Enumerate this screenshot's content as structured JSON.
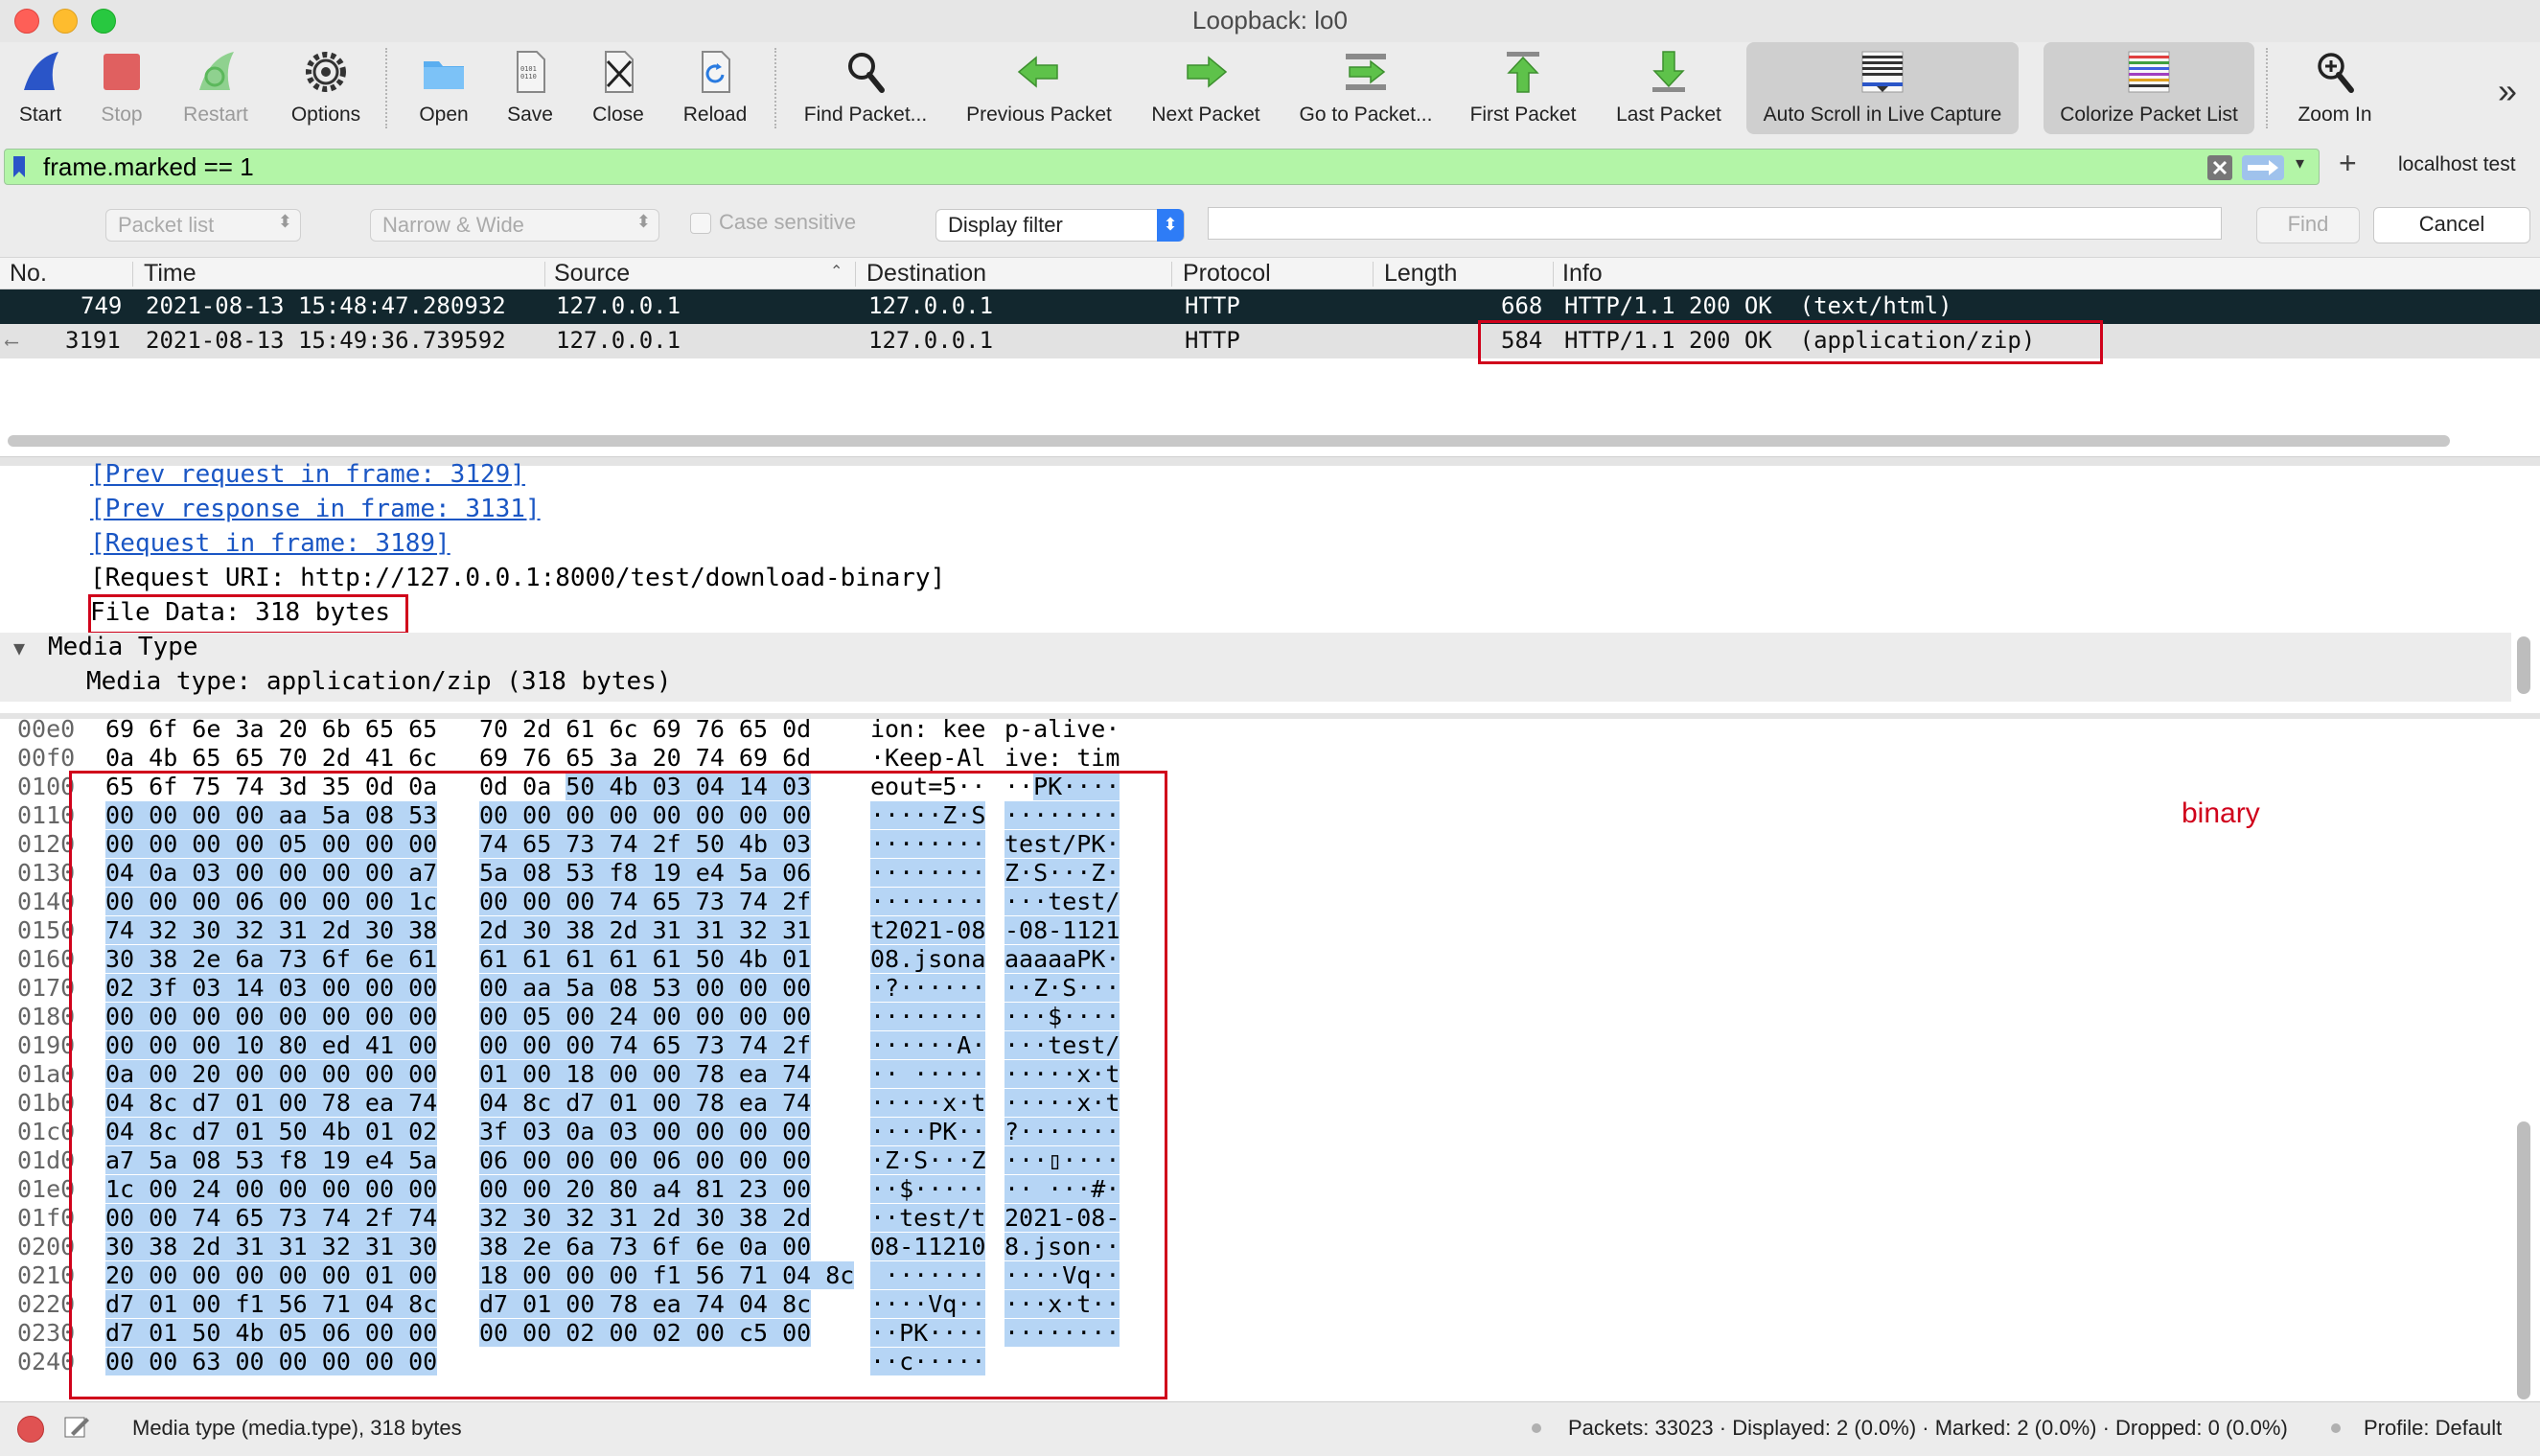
{
  "window": {
    "title": "Loopback: lo0"
  },
  "toolbar": {
    "items": [
      {
        "label": "Start",
        "icon": "shark-fin-icon"
      },
      {
        "label": "Stop",
        "icon": "stop-square-icon"
      },
      {
        "label": "Restart",
        "icon": "restart-fin-icon"
      },
      {
        "label": "Options",
        "icon": "gear-icon"
      },
      {
        "label": "Open",
        "icon": "folder-icon"
      },
      {
        "label": "Save",
        "icon": "save-file-icon"
      },
      {
        "label": "Close",
        "icon": "close-file-icon"
      },
      {
        "label": "Reload",
        "icon": "reload-icon"
      },
      {
        "label": "Find Packet...",
        "icon": "magnifier-icon"
      },
      {
        "label": "Previous Packet",
        "icon": "arrow-left-icon"
      },
      {
        "label": "Next Packet",
        "icon": "arrow-right-icon"
      },
      {
        "label": "Go to Packet...",
        "icon": "goto-icon"
      },
      {
        "label": "First Packet",
        "icon": "arrow-up-icon"
      },
      {
        "label": "Last Packet",
        "icon": "arrow-down-icon"
      },
      {
        "label": "Auto Scroll in Live Capture",
        "icon": "autoscroll-icon"
      },
      {
        "label": "Colorize Packet List",
        "icon": "colorize-icon"
      },
      {
        "label": "Zoom In",
        "icon": "zoom-in-icon"
      }
    ],
    "overflow": "»"
  },
  "filter": {
    "value": "frame.marked == 1",
    "add_button": "+",
    "profile_label": "localhost test"
  },
  "find": {
    "search_in": "Packet list",
    "char_width": "Narrow & Wide",
    "case_sensitive": "Case sensitive",
    "type": "Display filter",
    "find_button": "Find",
    "cancel_button": "Cancel"
  },
  "packet_list": {
    "columns": [
      "No.",
      "Time",
      "Source",
      "Destination",
      "Protocol",
      "Length",
      "Info"
    ],
    "rows": [
      {
        "no": "749",
        "time": "2021-08-13 15:48:47.280932",
        "source": "127.0.0.1",
        "destination": "127.0.0.1",
        "protocol": "HTTP",
        "length": "668",
        "info": "HTTP/1.1 200 OK  (text/html)"
      },
      {
        "no": "3191",
        "time": "2021-08-13 15:49:36.739592",
        "source": "127.0.0.1",
        "destination": "127.0.0.1",
        "protocol": "HTTP",
        "length": "584",
        "info": "HTTP/1.1 200 OK  (application/zip)"
      }
    ]
  },
  "details": {
    "lines": [
      "[Prev request in frame: 3129]",
      "[Prev response in frame: 3131]",
      "[Request in frame: 3189]",
      "[Request URI: http://127.0.0.1:8000/test/download-binary]",
      "File Data: 318 bytes"
    ],
    "media_header": "Media Type",
    "media_line": "Media type: application/zip (318 bytes)"
  },
  "bytes": [
    {
      "off": "00e0",
      "h1": "69 6f 6e 3a 20 6b 65 65",
      "h2": "70 2d 61 6c 69 76 65 0d",
      "a1": "ion: kee",
      "a2": "p-alive·"
    },
    {
      "off": "00f0",
      "h1": "0a 4b 65 65 70 2d 41 6c",
      "h2": "69 76 65 3a 20 74 69 6d",
      "a1": "·Keep-Al",
      "a2": "ive: tim"
    },
    {
      "off": "0100",
      "h1": "65 6f 75 74 3d 35 0d 0a",
      "h2": "0d 0a 50 4b 03 04 14 03",
      "a1": "eout=5··",
      "a2": "··PK····"
    },
    {
      "off": "0110",
      "h1": "00 00 00 00 aa 5a 08 53",
      "h2": "00 00 00 00 00 00 00 00",
      "a1": "·····Z·S",
      "a2": "········"
    },
    {
      "off": "0120",
      "h1": "00 00 00 00 05 00 00 00",
      "h2": "74 65 73 74 2f 50 4b 03",
      "a1": "········",
      "a2": "test/PK·"
    },
    {
      "off": "0130",
      "h1": "04 0a 03 00 00 00 00 a7",
      "h2": "5a 08 53 f8 19 e4 5a 06",
      "a1": "········",
      "a2": "Z·S···Z·"
    },
    {
      "off": "0140",
      "h1": "00 00 00 06 00 00 00 1c",
      "h2": "00 00 00 74 65 73 74 2f",
      "a1": "········",
      "a2": "···test/"
    },
    {
      "off": "0150",
      "h1": "74 32 30 32 31 2d 30 38",
      "h2": "2d 30 38 2d 31 31 32 31",
      "a1": "t2021-08",
      "a2": "-08-1121"
    },
    {
      "off": "0160",
      "h1": "30 38 2e 6a 73 6f 6e 61",
      "h2": "61 61 61 61 61 50 4b 01",
      "a1": "08.jsona",
      "a2": "aaaaaPK·"
    },
    {
      "off": "0170",
      "h1": "02 3f 03 14 03 00 00 00",
      "h2": "00 aa 5a 08 53 00 00 00",
      "a1": "·?······",
      "a2": "··Z·S···"
    },
    {
      "off": "0180",
      "h1": "00 00 00 00 00 00 00 00",
      "h2": "00 05 00 24 00 00 00 00",
      "a1": "········",
      "a2": "···$····"
    },
    {
      "off": "0190",
      "h1": "00 00 00 10 80 ed 41 00",
      "h2": "00 00 00 74 65 73 74 2f",
      "a1": "······A·",
      "a2": "···test/"
    },
    {
      "off": "01a0",
      "h1": "0a 00 20 00 00 00 00 00",
      "h2": "01 00 18 00 00 78 ea 74",
      "a1": "·· ·····",
      "a2": "·····x·t"
    },
    {
      "off": "01b0",
      "h1": "04 8c d7 01 00 78 ea 74",
      "h2": "04 8c d7 01 00 78 ea 74",
      "a1": "·····x·t",
      "a2": "·····x·t"
    },
    {
      "off": "01c0",
      "h1": "04 8c d7 01 50 4b 01 02",
      "h2": "3f 03 0a 03 00 00 00 00",
      "a1": "····PK··",
      "a2": "?·······"
    },
    {
      "off": "01d0",
      "h1": "a7 5a 08 53 f8 19 e4 5a",
      "h2": "06 00 00 00 06 00 00 00",
      "a1": "·Z·S···Z",
      "a2": "···▯····"
    },
    {
      "off": "01e0",
      "h1": "1c 00 24 00 00 00 00 00",
      "h2": "00 00 20 80 a4 81 23 00",
      "a1": "··$·····",
      "a2": "·· ···#·"
    },
    {
      "off": "01f0",
      "h1": "00 00 74 65 73 74 2f 74",
      "h2": "32 30 32 31 2d 30 38 2d",
      "a1": "··test/t",
      "a2": "2021-08-"
    },
    {
      "off": "0200",
      "h1": "30 38 2d 31 31 32 31 30",
      "h2": "38 2e 6a 73 6f 6e 0a 00",
      "a1": "08-11210",
      "a2": "8.json··"
    },
    {
      "off": "0210",
      "h1": "20 00 00 00 00 00 01 00",
      "h2": "18 00 00 00 f1 56 71 04 8c",
      "a1": " ·······",
      "a2": "····Vq··"
    },
    {
      "off": "0220",
      "h1": "d7 01 00 f1 56 71 04 8c",
      "h2": "d7 01 00 78 ea 74 04 8c",
      "a1": "····Vq··",
      "a2": "···x·t··"
    },
    {
      "off": "0230",
      "h1": "d7 01 50 4b 05 06 00 00",
      "h2": "00 00 02 00 02 00 c5 00",
      "a1": "··PK····",
      "a2": "········"
    },
    {
      "off": "0240",
      "h1": "00 00 63 00 00 00 00 00",
      "h2": "",
      "a1": "··c·····",
      "a2": ""
    }
  ],
  "annotation": {
    "label": "binary",
    "color": "#d0021b"
  },
  "status": {
    "field": "Media type (media.type), 318 bytes",
    "stats": "Packets: 33023 · Displayed: 2 (0.0%) · Marked: 2 (0.0%) · Dropped: 0 (0.0%)",
    "profile": "Profile: Default"
  }
}
